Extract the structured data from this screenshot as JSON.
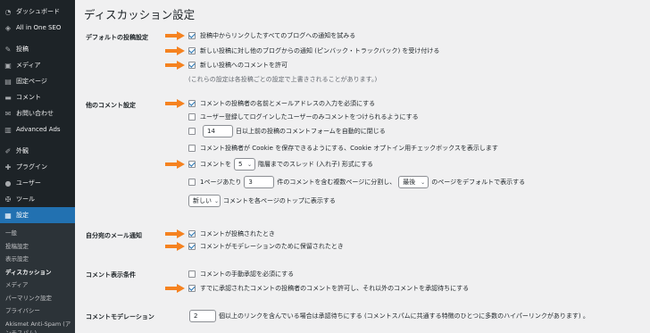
{
  "sidebar": {
    "items": [
      {
        "icon": "dashboard-icon",
        "glyph": "◔",
        "label": "ダッシュボード"
      },
      {
        "icon": "seo-icon",
        "glyph": "◈",
        "label": "All in One SEO"
      },
      {
        "icon": "pin-icon",
        "glyph": "✎",
        "label": "投稿"
      },
      {
        "icon": "media-icon",
        "glyph": "▣",
        "label": "メディア"
      },
      {
        "icon": "page-icon",
        "glyph": "▤",
        "label": "固定ページ"
      },
      {
        "icon": "comment-icon",
        "glyph": "▬",
        "label": "コメント"
      },
      {
        "icon": "mail-icon",
        "glyph": "✉",
        "label": "お問い合わせ"
      },
      {
        "icon": "ads-icon",
        "glyph": "▥",
        "label": "Advanced Ads"
      },
      {
        "icon": "appearance-icon",
        "glyph": "✐",
        "label": "外観"
      },
      {
        "icon": "plugin-icon",
        "glyph": "✚",
        "label": "プラグイン"
      },
      {
        "icon": "user-icon",
        "glyph": "●",
        "label": "ユーザー"
      },
      {
        "icon": "tool-icon",
        "glyph": "✠",
        "label": "ツール"
      },
      {
        "icon": "settings-icon",
        "glyph": "▦",
        "label": "設定"
      }
    ],
    "submenu": [
      "一般",
      "投稿設定",
      "表示設定",
      "ディスカッション",
      "メディア",
      "パーマリンク設定",
      "プライバシー",
      "Akismet Anti-Spam (アンチスパム)"
    ]
  },
  "page_title": "ディスカッション設定",
  "sections": {
    "default_post": {
      "label": "デフォルトの投稿設定",
      "opt1": "投稿中からリンクしたすべてのブログへの通知を試みる",
      "opt2": "新しい投稿に対し他のブログからの通知 (ピンバック・トラックバック) を受け付ける",
      "opt3": "新しい投稿へのコメントを許可",
      "note": "(これらの設定は各投稿ごとの設定で上書きされることがあります。)"
    },
    "other_comment": {
      "label": "他のコメント設定",
      "opt1": "コメントの投稿者の名前とメールアドレスの入力を必須にする",
      "opt2": "ユーザー登録してログインしたユーザーのみコメントをつけられるようにする",
      "close_days": "14",
      "opt3": "日以上前の投稿のコメントフォームを自動的に閉じる",
      "opt4": "コメント投稿者が Cookie を保存できるようにする、Cookie オプトイン用チェックボックスを表示します",
      "opt5_pre": "コメントを",
      "thread_depth": "5",
      "opt5_post": "階層までのスレッド (入れ子) 形式にする",
      "opt6_pre": "1ページあたり",
      "per_page": "3",
      "opt6_mid": "件のコメントを含む複数ページに分割し、",
      "page_select": "最後",
      "opt6_post": "のページをデフォルトで表示する",
      "order_select": "新しい",
      "order_post": "コメントを各ページのトップに表示する"
    },
    "email_notify": {
      "label": "自分宛のメール通知",
      "opt1": "コメントが投稿されたとき",
      "opt2": "コメントがモデレーションのために保留されたとき"
    },
    "display_cond": {
      "label": "コメント表示条件",
      "opt1": "コメントの手動承認を必須にする",
      "opt2": "すでに承認されたコメントの投稿者のコメントを許可し、それ以外のコメントを承認待ちにする"
    },
    "moderation": {
      "label": "コメントモデレーション",
      "links": "2",
      "text": "個以上のリンクを含んでいる場合は承認待ちにする (コメントスパムに共通する特徴のひとつに多数のハイパーリンクがあります) 。"
    }
  },
  "colors": {
    "arrow": "#f58220",
    "accent": "#2271b1",
    "sidebar": "#1d2327"
  }
}
